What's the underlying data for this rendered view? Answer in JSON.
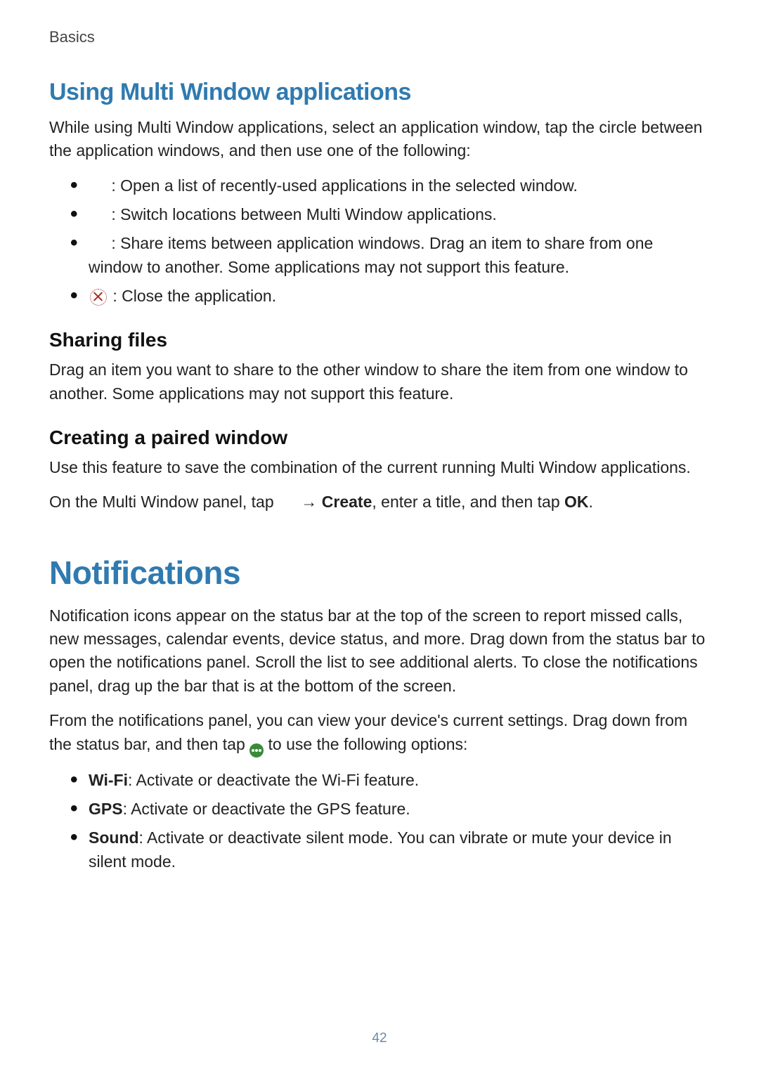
{
  "breadcrumb": "Basics",
  "page_number": "42",
  "sections": {
    "multiwindow": {
      "heading": "Using Multi Window applications",
      "intro": "While using Multi Window applications, select an application window, tap the circle between the application windows, and then use one of the following:",
      "bullets": [
        " : Open a list of recently-used applications in the selected window.",
        " : Switch locations between Multi Window applications.",
        " : Share items between application windows. Drag an item to share from one window to another. Some applications may not support this feature.",
        " : Close the application."
      ],
      "sharing": {
        "heading": "Sharing files",
        "body": "Drag an item you want to share to the other window to share the item from one window to another. Some applications may not support this feature."
      },
      "paired": {
        "heading": "Creating a paired window",
        "body1": "Use this feature to save the combination of the current running Multi Window applications.",
        "body2_pre": "On the Multi Window panel, tap ",
        "body2_arrow": " → ",
        "body2_bold1": "Create",
        "body2_mid": ", enter a title, and then tap ",
        "body2_bold2": "OK",
        "body2_end": "."
      }
    },
    "notifications": {
      "heading": "Notifications",
      "p1": "Notification icons appear on the status bar at the top of the screen to report missed calls, new messages, calendar events, device status, and more. Drag down from the status bar to open the notifications panel. Scroll the list to see additional alerts. To close the notifications panel, drag up the bar that is at the bottom of the screen.",
      "p2_pre": "From the notifications panel, you can view your device's current settings. Drag down from the status bar, and then tap ",
      "p2_post": " to use the following options:",
      "options": {
        "wifi": {
          "label": "Wi-Fi",
          "desc": ": Activate or deactivate the Wi-Fi feature."
        },
        "gps": {
          "label": "GPS",
          "desc": ": Activate or deactivate the GPS feature."
        },
        "sound": {
          "label": "Sound",
          "desc": ": Activate or deactivate silent mode. You can vibrate or mute your device in silent mode."
        }
      }
    }
  }
}
